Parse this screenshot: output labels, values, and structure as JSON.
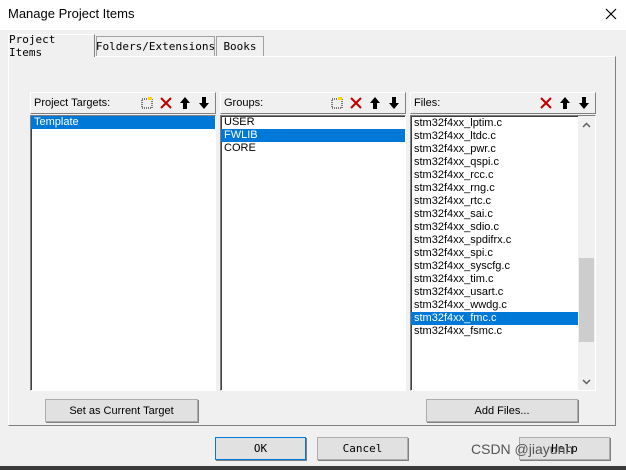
{
  "window": {
    "title": "Manage Project Items",
    "close_glyph": "✕"
  },
  "tabs": [
    {
      "label": "Project Items",
      "active": true
    },
    {
      "label": "Folders/Extensions",
      "active": false
    },
    {
      "label": "Books",
      "active": false
    }
  ],
  "targets_pane": {
    "label": "Project Targets:",
    "items": [
      "Template"
    ],
    "selected_index": 0,
    "tools": [
      "new-icon",
      "delete-icon",
      "move-up-icon",
      "move-down-icon"
    ]
  },
  "groups_pane": {
    "label": "Groups:",
    "items": [
      "USER",
      "FWLIB",
      "CORE"
    ],
    "selected_index": 1,
    "tools": [
      "new-icon",
      "delete-icon",
      "move-up-icon",
      "move-down-icon"
    ]
  },
  "files_pane": {
    "label": "Files:",
    "items": [
      "stm32f4xx_lptim.c",
      "stm32f4xx_ltdc.c",
      "stm32f4xx_pwr.c",
      "stm32f4xx_qspi.c",
      "stm32f4xx_rcc.c",
      "stm32f4xx_rng.c",
      "stm32f4xx_rtc.c",
      "stm32f4xx_sai.c",
      "stm32f4xx_sdio.c",
      "stm32f4xx_spdifrx.c",
      "stm32f4xx_spi.c",
      "stm32f4xx_syscfg.c",
      "stm32f4xx_tim.c",
      "stm32f4xx_usart.c",
      "stm32f4xx_wwdg.c",
      "stm32f4xx_fmc.c",
      "stm32f4xx_fsmc.c"
    ],
    "selected_index": 15,
    "tools": [
      "delete-icon",
      "move-up-icon",
      "move-down-icon"
    ]
  },
  "buttons": {
    "set_current_target": "Set as Current Target",
    "add_files": "Add Files...",
    "ok": "OK",
    "cancel": "Cancel",
    "help": "Help"
  },
  "watermark": "CSDN @jiayunh",
  "colors": {
    "selection": "#0078d7",
    "dialog_bg": "#f0f0f0",
    "delete_red": "#c00000"
  }
}
